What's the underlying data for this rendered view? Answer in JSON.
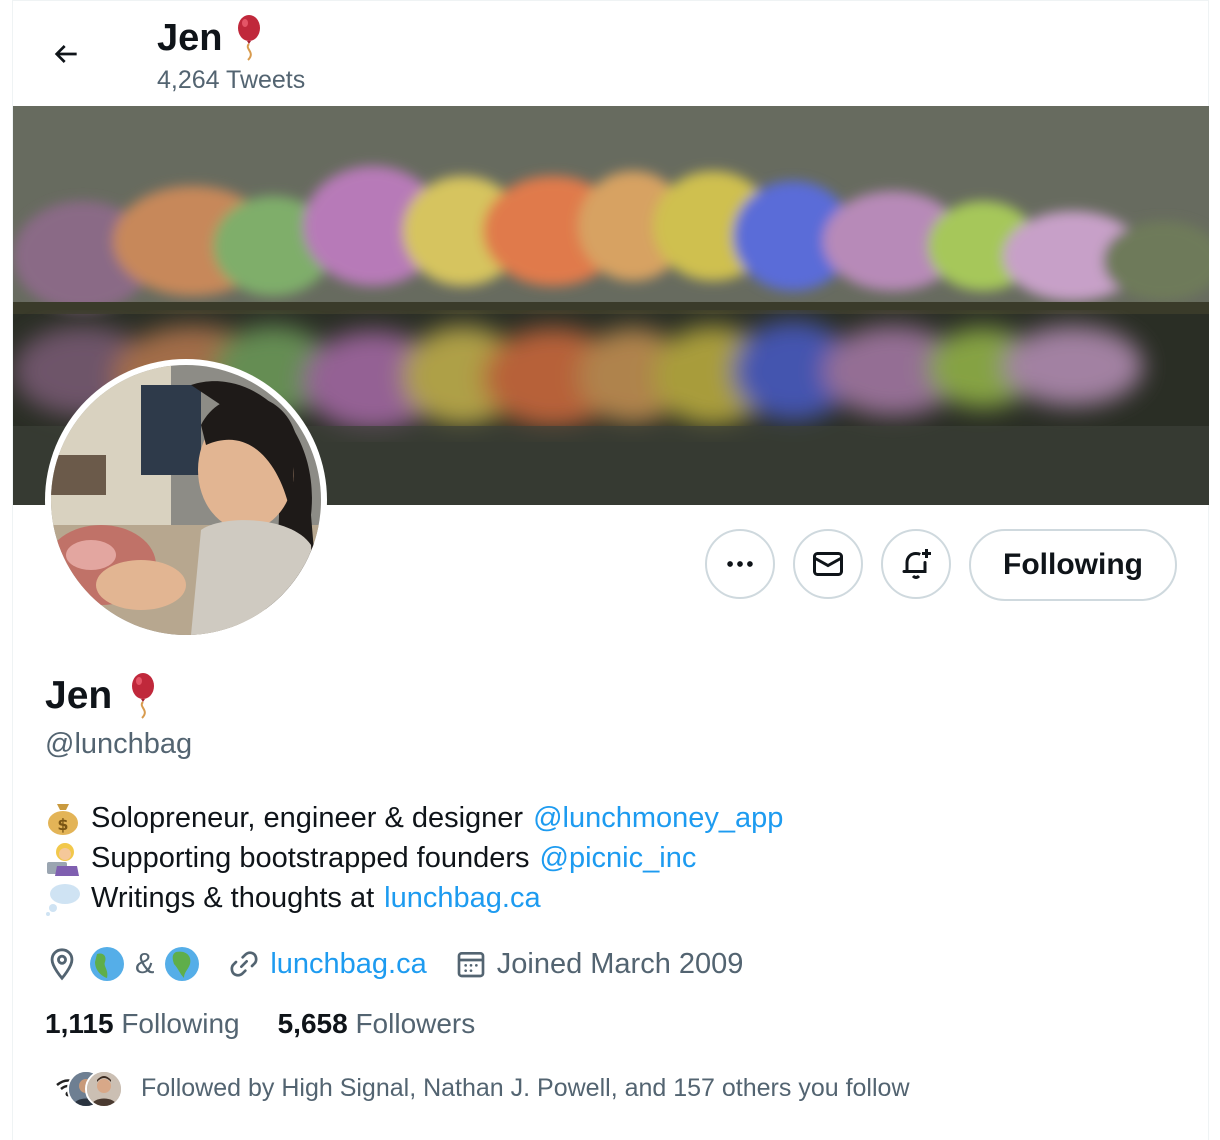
{
  "header": {
    "name": "Jen",
    "tweets_count": "4,264 Tweets"
  },
  "profile": {
    "name": "Jen",
    "handle": "@lunchbag",
    "bio": [
      {
        "emoji": "money-bag",
        "text": "Solopreneur, engineer & designer ",
        "link": "@lunchmoney_app"
      },
      {
        "emoji": "technologist",
        "text": "Supporting bootstrapped founders ",
        "link": "@picnic_inc"
      },
      {
        "emoji": "thought-balloon",
        "text": "Writings & thoughts at ",
        "link": "lunchbag.ca"
      }
    ],
    "location_separator": "&",
    "website": "lunchbag.ca",
    "joined": "Joined March 2009",
    "following_count": "1,115",
    "following_label": "Following",
    "followers_count": "5,658",
    "followers_label": "Followers",
    "followed_by": "Followed by High Signal, Nathan J. Powell, and 157 others you follow"
  },
  "actions": {
    "more_icon": "more-icon",
    "message_icon": "mail-icon",
    "notify_icon": "bell-plus-icon",
    "following_button": "Following"
  },
  "colors": {
    "link": "#1d9bf0",
    "secondary_text": "#536471",
    "border": "#cfd9de"
  }
}
